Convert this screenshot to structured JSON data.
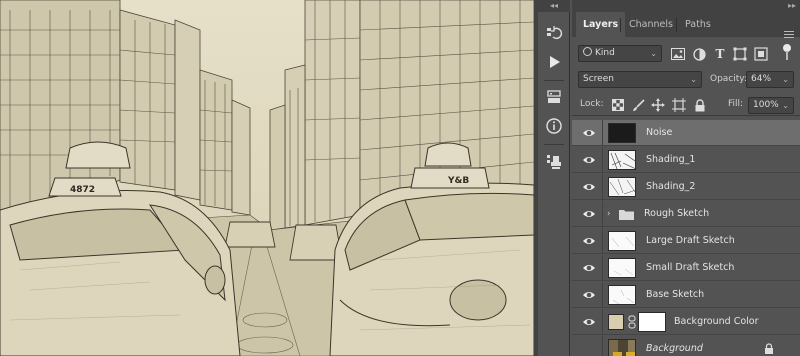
{
  "canvas": {
    "taxi_sign_left": "4872",
    "taxi_sign_right": "Y&B"
  },
  "toolstrip": {
    "collapse_glyph": "◂◂",
    "items": [
      {
        "icon": "history-icon"
      },
      {
        "icon": "play-actions-icon"
      },
      {
        "icon": "layer-comps-icon"
      },
      {
        "icon": "info-icon"
      },
      {
        "icon": "clone-source-icon"
      }
    ]
  },
  "panel": {
    "collapse_glyph": "▸▸",
    "tabs": [
      {
        "label": "Layers",
        "active": true
      },
      {
        "label": "Channels",
        "active": false
      },
      {
        "label": "Paths",
        "active": false
      }
    ],
    "filter": {
      "kind_label": "Kind"
    },
    "blend": {
      "mode": "Screen",
      "opacity_label": "Opacity:",
      "opacity_value": "64%"
    },
    "lock": {
      "lock_label": "Lock:",
      "fill_label": "Fill:",
      "fill_value": "100%"
    },
    "layers": [
      {
        "name": "Noise",
        "visible": true,
        "selected": true,
        "thumb": "noise"
      },
      {
        "name": "Shading_1",
        "visible": true,
        "selected": false,
        "thumb": "sketch"
      },
      {
        "name": "Shading_2",
        "visible": true,
        "selected": false,
        "thumb": "sketch"
      },
      {
        "name": "Rough Sketch",
        "visible": true,
        "selected": false,
        "thumb": "folder"
      },
      {
        "name": "Large Draft Sketch",
        "visible": true,
        "selected": false,
        "thumb": "light"
      },
      {
        "name": "Small Draft Sketch",
        "visible": true,
        "selected": false,
        "thumb": "light"
      },
      {
        "name": "Base Sketch",
        "visible": true,
        "selected": false,
        "thumb": "light"
      },
      {
        "name": "Background Color",
        "visible": true,
        "selected": false,
        "thumb": "fill"
      },
      {
        "name": "Background",
        "visible": false,
        "selected": false,
        "thumb": "photo",
        "italic": true,
        "locked": true
      }
    ]
  },
  "colors": {
    "panel_bg": "#535353",
    "tab_bar": "#424242",
    "selected_layer": "#6e6e6e",
    "sketch_paper": "#d9d2b8",
    "background_color_swatch": "#d6ceae"
  }
}
